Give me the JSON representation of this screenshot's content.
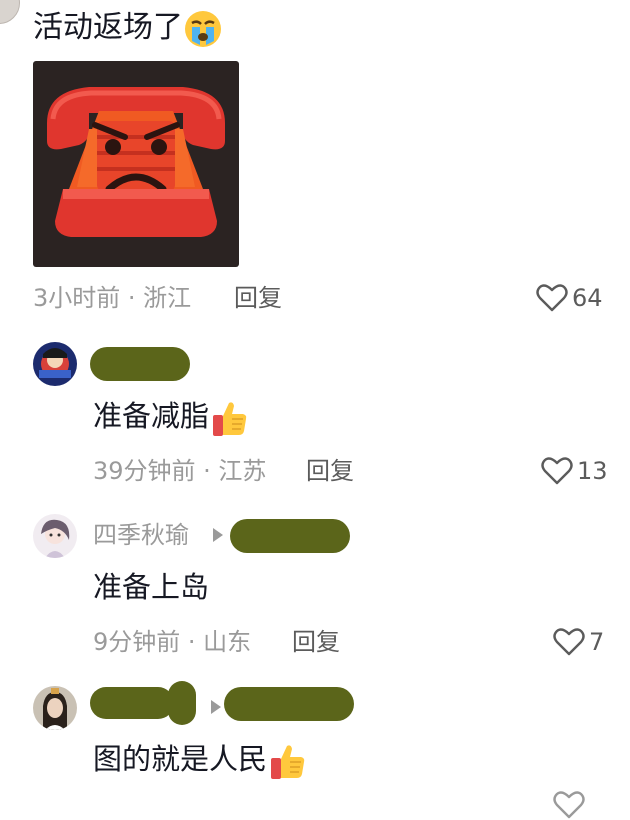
{
  "comments": {
    "main": {
      "text": "活动返场了",
      "time_location": "3小时前 · 浙江",
      "reply_label": "回复",
      "likes": "64"
    },
    "reply1": {
      "text": "准备减脂",
      "time_location": "39分钟前 · 江苏",
      "reply_label": "回复",
      "likes": "13"
    },
    "reply2": {
      "username": "四季秋瑜",
      "text": "准备上岛",
      "time_location": "9分钟前 · 山东",
      "reply_label": "回复",
      "likes": "7"
    },
    "reply3": {
      "text": "图的就是人民"
    }
  }
}
